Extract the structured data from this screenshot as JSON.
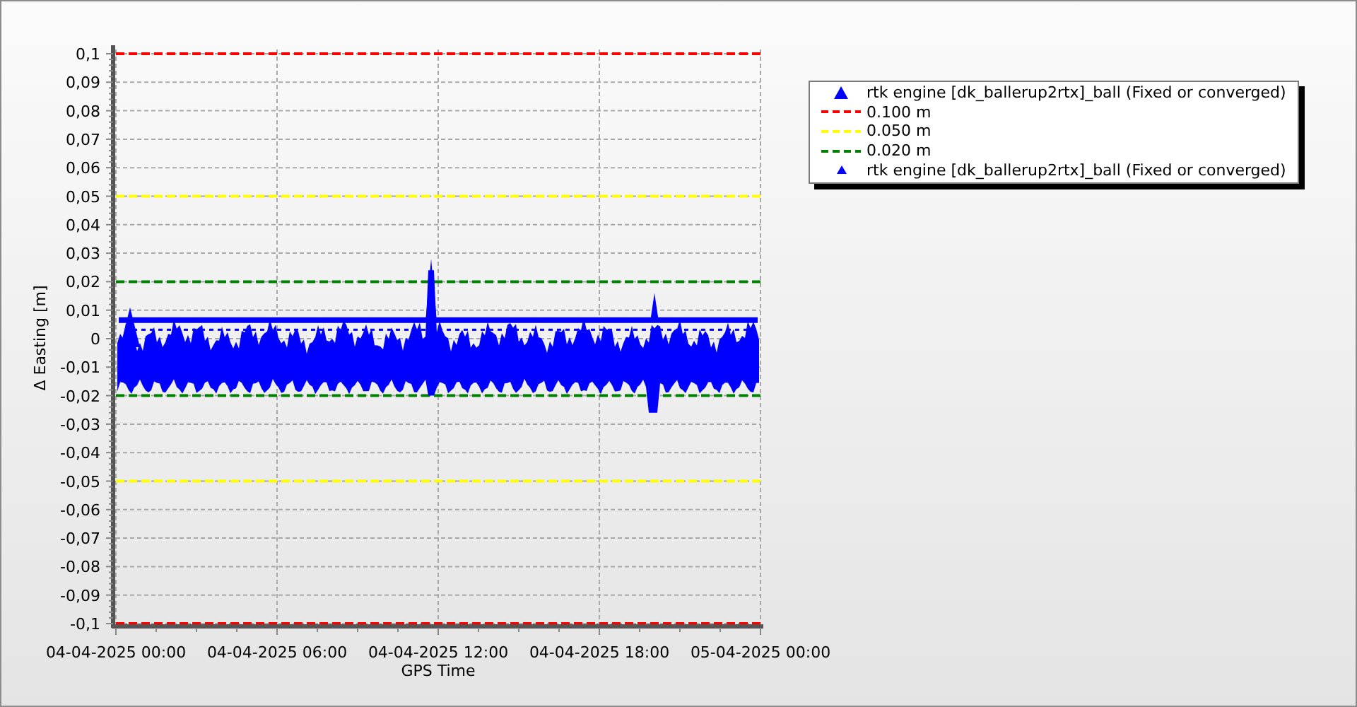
{
  "chart": {
    "chart_data": {
      "type": "line",
      "grid": true,
      "xlabel": "GPS Time",
      "ylabel": "Δ Easting [m]",
      "categories": [
        "04-04-2025 00:00",
        "04-04-2025 06:00",
        "04-04-2025 12:00",
        "04-04-2025 18:00",
        "05-04-2025 00:00"
      ],
      "ylim": [
        -0.1,
        0.1
      ],
      "yticks": [
        {
          "value": 0.1,
          "label": "0,1"
        },
        {
          "value": 0.09,
          "label": "0,09"
        },
        {
          "value": 0.08,
          "label": "0,08"
        },
        {
          "value": 0.07,
          "label": "0,07"
        },
        {
          "value": 0.06,
          "label": "0,06"
        },
        {
          "value": 0.05,
          "label": "0,05"
        },
        {
          "value": 0.04,
          "label": "0,04"
        },
        {
          "value": 0.03,
          "label": "0,03"
        },
        {
          "value": 0.02,
          "label": "0,02"
        },
        {
          "value": 0.01,
          "label": "0,01"
        },
        {
          "value": 0,
          "label": "0"
        },
        {
          "value": -0.01,
          "label": "-0,01"
        },
        {
          "value": -0.02,
          "label": "-0,02"
        },
        {
          "value": -0.03,
          "label": "-0,03"
        },
        {
          "value": -0.04,
          "label": "-0,04"
        },
        {
          "value": -0.05,
          "label": "-0,05"
        },
        {
          "value": -0.06,
          "label": "-0,06"
        },
        {
          "value": -0.07,
          "label": "-0,07"
        },
        {
          "value": -0.08,
          "label": "-0,08"
        },
        {
          "value": -0.09,
          "label": "-0,09"
        },
        {
          "value": -0.1,
          "label": "-0,1"
        }
      ],
      "series": [
        {
          "color": "#ff0000",
          "line_style": "dashed",
          "values": [
            0.1,
            0.1,
            0.1,
            0.1,
            0.1
          ]
        },
        {
          "color": "#ff0000",
          "line_style": "dashed",
          "values": [
            -0.1,
            -0.1,
            -0.1,
            -0.1,
            -0.1
          ]
        },
        {
          "color": "#ffff00",
          "line_style": "dashed",
          "values": [
            0.05,
            0.05,
            0.05,
            0.05,
            0.05
          ]
        },
        {
          "color": "#ffff00",
          "line_style": "dashed",
          "values": [
            -0.05,
            -0.05,
            -0.05,
            -0.05,
            -0.05
          ]
        },
        {
          "color": "#008000",
          "line_style": "dashed",
          "values": [
            0.02,
            0.02,
            0.02,
            0.02,
            0.02
          ]
        },
        {
          "color": "#008000",
          "line_style": "dashed",
          "values": [
            -0.02,
            -0.02,
            -0.02,
            -0.02,
            -0.02
          ]
        }
      ]
    }
  },
  "legend": [
    {
      "kind": "triangle",
      "label": "rtk engine [dk_ballerup2rtx]_ball (Fixed or converged)",
      "color": "#0000ff"
    },
    {
      "kind": "dash",
      "label": "0.100 m",
      "color": "#ff0000"
    },
    {
      "kind": "dash",
      "label": "0.050 m",
      "color": "#ffff00"
    },
    {
      "kind": "dash",
      "label": "0.020 m",
      "color": "#008000"
    },
    {
      "kind": "small-triangle",
      "label": "rtk engine [dk_ballerup2rtx]_ball (Fixed or converged)",
      "color": "#0000ff"
    }
  ]
}
